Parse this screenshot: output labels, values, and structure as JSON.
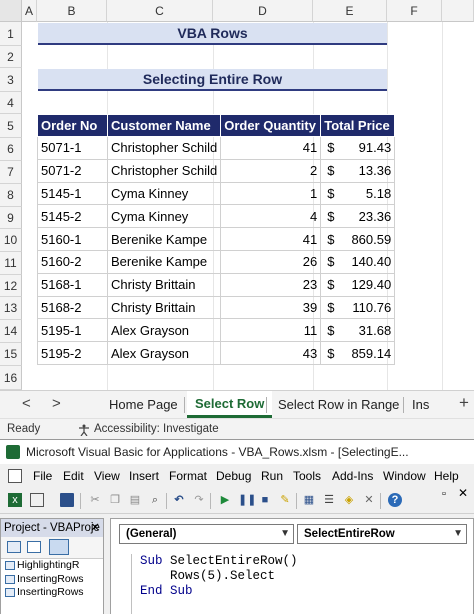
{
  "columns": [
    "A",
    "B",
    "C",
    "D",
    "E",
    "F"
  ],
  "rows": [
    "1",
    "2",
    "3",
    "4",
    "5",
    "6",
    "7",
    "8",
    "9",
    "10",
    "11",
    "12",
    "13",
    "14",
    "15",
    "16"
  ],
  "sheet": {
    "title": "VBA Rows",
    "subtitle": "Selecting Entire Row",
    "headers": [
      "Order No",
      "Customer Name",
      "Order Quantity",
      "Total Price"
    ],
    "currency": "$",
    "data": [
      {
        "order": "5071-1",
        "customer": "Christopher Schild",
        "qty": "41",
        "price": "91.43"
      },
      {
        "order": "5071-2",
        "customer": "Christopher Schild",
        "qty": "2",
        "price": "13.36"
      },
      {
        "order": "5145-1",
        "customer": "Cyma Kinney",
        "qty": "1",
        "price": "5.18"
      },
      {
        "order": "5145-2",
        "customer": "Cyma Kinney",
        "qty": "4",
        "price": "23.36"
      },
      {
        "order": "5160-1",
        "customer": "Berenike Kampe",
        "qty": "41",
        "price": "860.59"
      },
      {
        "order": "5160-2",
        "customer": "Berenike Kampe",
        "qty": "26",
        "price": "140.40"
      },
      {
        "order": "5168-1",
        "customer": "Christy Brittain",
        "qty": "23",
        "price": "129.40"
      },
      {
        "order": "5168-2",
        "customer": "Christy Brittain",
        "qty": "39",
        "price": "110.76"
      },
      {
        "order": "5195-1",
        "customer": "Alex Grayson",
        "qty": "11",
        "price": "31.68"
      },
      {
        "order": "5195-2",
        "customer": "Alex Grayson",
        "qty": "43",
        "price": "859.14"
      }
    ]
  },
  "tabs": {
    "prev": "<",
    "next": ">",
    "items": [
      "Home Page",
      "Select Row",
      "Select Row in Range",
      "Ins"
    ],
    "active_index": 1,
    "add": "+"
  },
  "status": {
    "ready": "Ready",
    "accessibility": "Accessibility: Investigate"
  },
  "vbe": {
    "title": "Microsoft Visual Basic for Applications - VBA_Rows.xlsm - [SelectingE...",
    "menu": [
      "File",
      "Edit",
      "View",
      "Insert",
      "Format",
      "Debug",
      "Run",
      "Tools",
      "Add-Ins",
      "Window",
      "Help"
    ],
    "project_title": "Project - VBAProje",
    "project_items": [
      "HighlightingR",
      "InsertingRows",
      "InsertingRows"
    ],
    "general_dropdown": "(General)",
    "proc_dropdown": "SelectEntireRow",
    "code_line1_kw": "Sub",
    "code_line1_rest": " SelectEntireRow()",
    "code_line2": "    Rows(5).Select",
    "code_line3_kw": "End Sub"
  },
  "colors": {
    "header_fill": "#1f2a6b",
    "banner_fill": "#d9e1f2",
    "active_tab": "#1e6b35"
  }
}
